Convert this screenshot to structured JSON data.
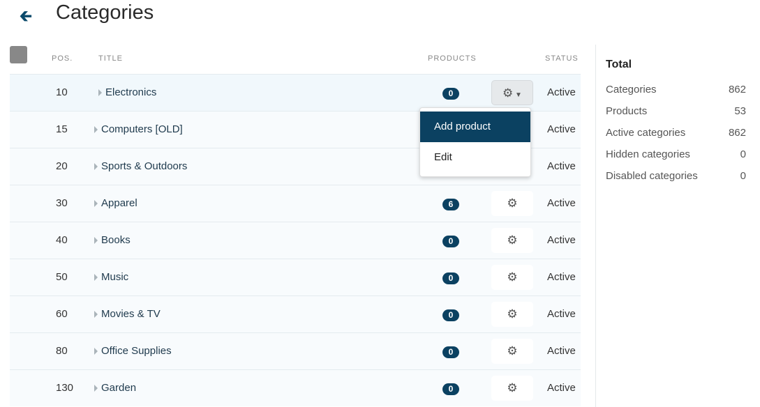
{
  "header": {
    "back_icon": "arrow-left-icon",
    "title": "Categories"
  },
  "table": {
    "columns": {
      "pos": "POS.",
      "title": "TITLE",
      "products": "PRODUCTS",
      "status": "STATUS"
    },
    "rows": [
      {
        "pos": "10",
        "title": "Electronics",
        "products": "0",
        "status": "Active"
      },
      {
        "pos": "15",
        "title": "Computers [OLD]",
        "products": "",
        "status": "Active"
      },
      {
        "pos": "20",
        "title": "Sports & Outdoors",
        "products": "",
        "status": "Active"
      },
      {
        "pos": "30",
        "title": "Apparel",
        "products": "6",
        "status": "Active"
      },
      {
        "pos": "40",
        "title": "Books",
        "products": "0",
        "status": "Active"
      },
      {
        "pos": "50",
        "title": "Music",
        "products": "0",
        "status": "Active"
      },
      {
        "pos": "60",
        "title": "Movies & TV",
        "products": "0",
        "status": "Active"
      },
      {
        "pos": "80",
        "title": "Office Supplies",
        "products": "0",
        "status": "Active"
      },
      {
        "pos": "130",
        "title": "Garden",
        "products": "0",
        "status": "Active"
      }
    ]
  },
  "dropdown": {
    "items": [
      "Add product",
      "Edit"
    ]
  },
  "sidebar": {
    "title": "Total",
    "stats": [
      {
        "label": "Categories",
        "value": "862"
      },
      {
        "label": "Products",
        "value": "53"
      },
      {
        "label": "Active categories",
        "value": "862"
      },
      {
        "label": "Hidden categories",
        "value": "0"
      },
      {
        "label": "Disabled categories",
        "value": "0"
      }
    ]
  },
  "colors": {
    "accent": "#0b4161"
  }
}
